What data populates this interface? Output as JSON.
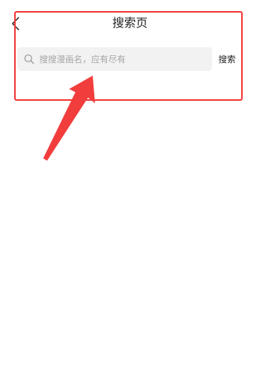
{
  "nav": {
    "title": "搜索页"
  },
  "search": {
    "placeholder": "搜搜漫画名，应有尽有",
    "value": "",
    "submit_label": "搜索"
  },
  "icons": {
    "back": "chevron-left-icon",
    "search": "search-icon"
  },
  "annotation": {
    "highlight_color": "#f23d3d"
  }
}
